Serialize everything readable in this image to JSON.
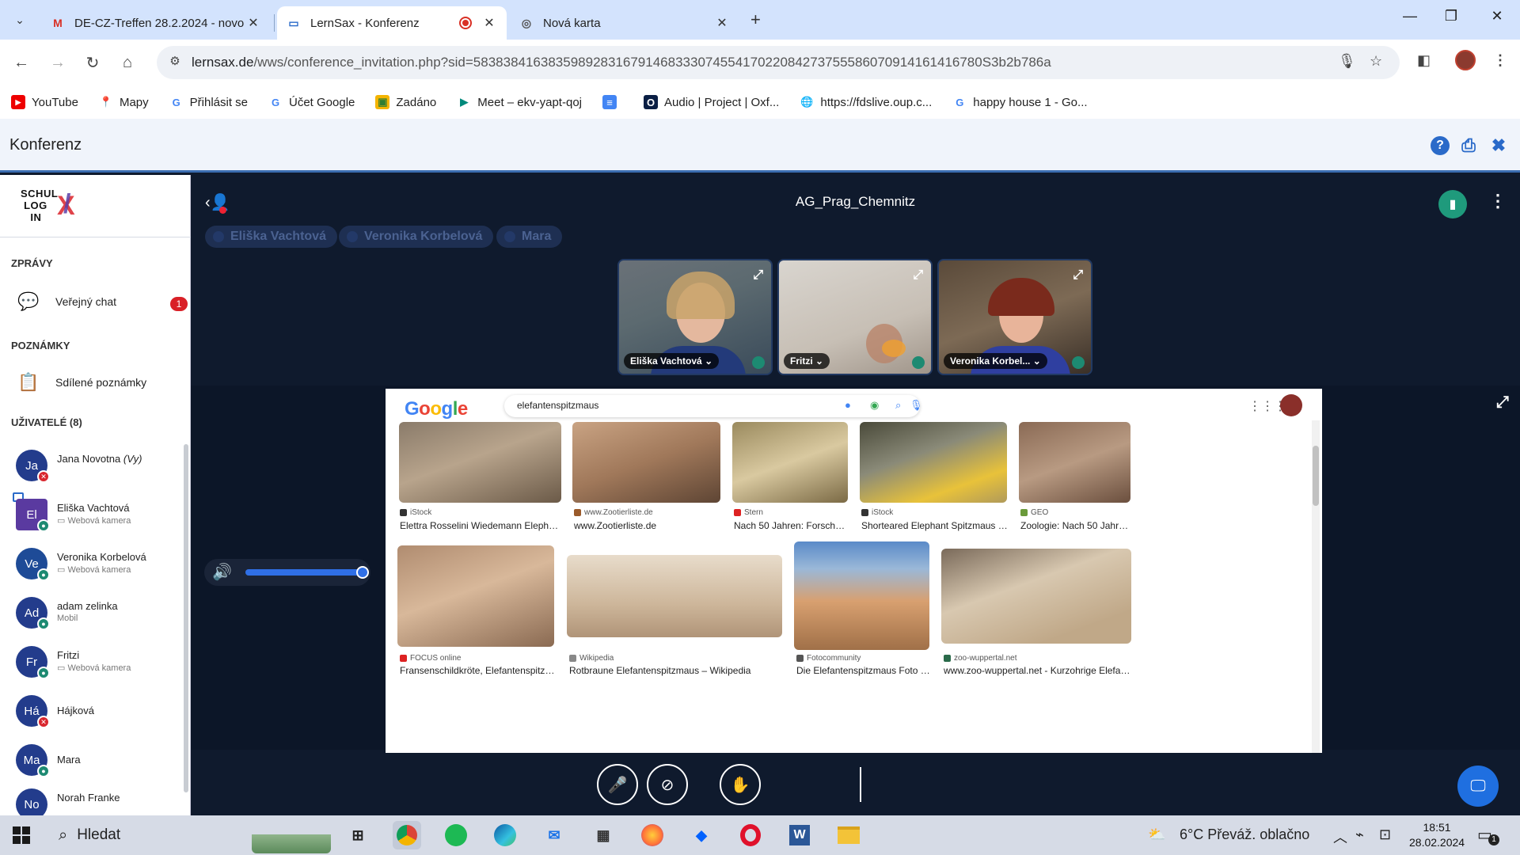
{
  "browser": {
    "tabs": [
      {
        "title": "DE-CZ-Treffen 28.2.2024 - novo",
        "icon": "gmail-icon",
        "active": false
      },
      {
        "title": "LernSax - Konferenz",
        "icon": "laptop-icon",
        "active": true
      },
      {
        "title": "Nová karta",
        "icon": "chrome-icon",
        "active": false
      }
    ],
    "url_host": "lernsax.de",
    "url_path": "/wws/conference_invitation.php?sid=583838416383598928316791468333074554170220842737555860709141614167​80S3b2b786a",
    "bookmarks": [
      "YouTube",
      "Mapy",
      "Přihlásit se",
      "Účet Google",
      "Zadáno",
      "Meet – ekv-yapt-qoj",
      "",
      "Audio | Project | Oxf...",
      "https://fdslive.oup.c...",
      "happy house 1 - Go..."
    ]
  },
  "app": {
    "title": "Konferenz"
  },
  "sidebar": {
    "section_messages": "ZPRÁVY",
    "public_chat": "Veřejný chat",
    "public_chat_badge": "1",
    "section_notes": "POZNÁMKY",
    "shared_notes": "Sdílené poznámky",
    "section_users": "UŽIVATELÉ (8)",
    "users": [
      {
        "initials": "Ja",
        "name": "Jana Novotna",
        "you": "(Vy)",
        "sub": "",
        "status": "red"
      },
      {
        "initials": "El",
        "name": "Eliška Vachtová",
        "sub": "Webová kamera",
        "status": "green"
      },
      {
        "initials": "Ve",
        "name": "Veronika Korbelová",
        "sub": "Webová kamera",
        "status": "green"
      },
      {
        "initials": "Ad",
        "name": "adam zelinka",
        "sub": "Mobil",
        "status": "green"
      },
      {
        "initials": "Fr",
        "name": "Fritzi",
        "sub": "Webová kamera",
        "status": "green"
      },
      {
        "initials": "Há",
        "name": "Hájková",
        "sub": "",
        "status": "red"
      },
      {
        "initials": "Ma",
        "name": "Mara",
        "sub": "",
        "status": "green"
      },
      {
        "initials": "No",
        "name": "Norah Franke",
        "sub": "",
        "status": "green"
      }
    ]
  },
  "conference": {
    "room_name": "AG_Prag_Chemnitz",
    "talkers": [
      "Eliška Vachtová",
      "Veronika Korbelová",
      "Mara"
    ],
    "videos": [
      {
        "label": "Eliška Vachtová"
      },
      {
        "label": "Fritzi"
      },
      {
        "label": "Veronika Korbel..."
      }
    ],
    "volume_level": 1.0
  },
  "screenshare": {
    "search_query": "elefantenspitzmaus",
    "results": [
      {
        "source": "iStock",
        "caption": "Elettra Rosselini Wiedemann Elephantu..."
      },
      {
        "source": "www.Zootierliste.de",
        "caption": "www.Zootierliste.de"
      },
      {
        "source": "Stern",
        "caption": "Nach 50 Jahren: Forscher ..."
      },
      {
        "source": "iStock",
        "caption": "Shorteared Elephant Spitzmaus Sto..."
      },
      {
        "source": "GEO",
        "caption": "Zoologie: Nach 50 Jahren..."
      },
      {
        "source": "FOCUS online",
        "caption": "Fransenschildkröte, Elefantenspitzma..."
      },
      {
        "source": "Wikipedia",
        "caption": "Rotbraune Elefantenspitzmaus – Wikipedia"
      },
      {
        "source": "Fotocommunity",
        "caption": "Die Elefantenspitzmaus Foto & ..."
      },
      {
        "source": "zoo-wuppertal.net",
        "caption": "www.zoo-wuppertal.net - Kurzohrige Elefanten..."
      }
    ]
  },
  "taskbar": {
    "search_label": "Hledat",
    "weather": "6°C  Převáž. oblačno",
    "time": "18:51",
    "date": "28.02.2024",
    "notifications": "1"
  }
}
